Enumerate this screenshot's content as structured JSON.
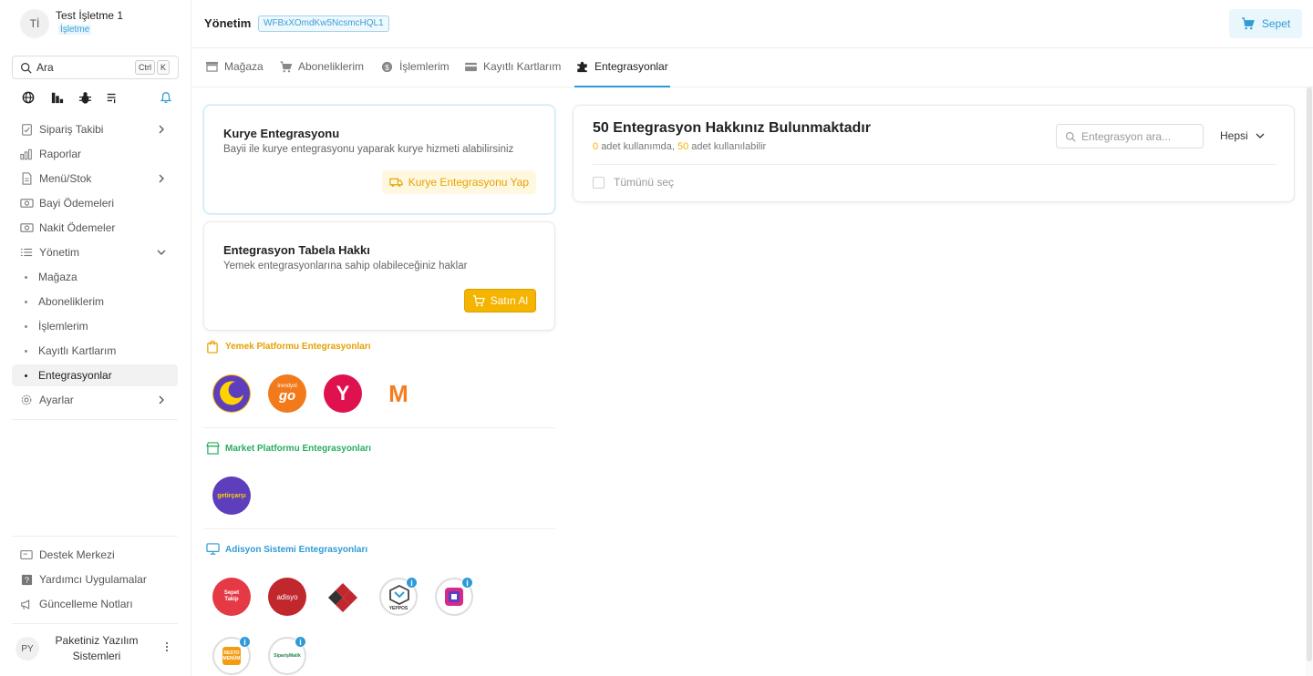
{
  "org": {
    "initials": "Tİ",
    "name": "Test İşletme 1",
    "type": "İşletme"
  },
  "search": {
    "label": "Ara",
    "key1": "Ctrl",
    "key2": "K"
  },
  "quick_icons": [
    "globe-icon",
    "chart-icon",
    "bug-icon",
    "list-icon",
    "bell-icon"
  ],
  "nav": {
    "siparis": "Sipariş Takibi",
    "raporlar": "Raporlar",
    "menu": "Menü/Stok",
    "bayi": "Bayi Ödemeleri",
    "nakit": "Nakit Ödemeler",
    "yonetim": "Yönetim",
    "sub": [
      "Mağaza",
      "Aboneliklerim",
      "İşlemlerim",
      "Kayıtlı Kartlarım",
      "Entegrasyonlar"
    ],
    "ayarlar": "Ayarlar"
  },
  "footer_links": {
    "destek": "Destek Merkezi",
    "yardimci": "Yardımcı Uygulamalar",
    "guncelleme": "Güncelleme Notları"
  },
  "user": {
    "initials": "PY",
    "name": "Paketiniz Yazılım Sistemleri"
  },
  "header": {
    "title": "Yönetim",
    "id": "WFBxXOmdKw5NcsmcHQL1",
    "cart": "Sepet"
  },
  "tabs": [
    "Mağaza",
    "Aboneliklerim",
    "İşlemlerim",
    "Kayıtlı Kartlarım",
    "Entegrasyonlar"
  ],
  "courier_card": {
    "title": "Kurye Entegrasyonu",
    "desc": "Bayii ile kurye entegrasyonu yaparak kurye hizmeti alabilirsiniz",
    "button": "Kurye Entegrasyonu Yap"
  },
  "sign_card": {
    "title": "Entegrasyon Tabela Hakkı",
    "desc": "Yemek entegrasyonlarına sahip olabileceğiniz haklar",
    "button": "Satın Al"
  },
  "sections": {
    "yemek": {
      "title": "Yemek Platformu Entegrasyonları",
      "color": "#e6a100"
    },
    "market": {
      "title": "Market Platformu Entegrasyonları",
      "color": "#27ae60"
    },
    "adisyon": {
      "title": "Adisyon Sistemi Entegrasyonları",
      "color": "#2f9bd6"
    }
  },
  "logos": {
    "yemek": [
      "migros-logo",
      "trendyolgo-logo",
      "yemeksepeti-logo",
      "m-logo"
    ],
    "trendyol_text": "trendyol",
    "trendyol_go": "go",
    "yemeksepeti_text": "Y",
    "m_text": "M",
    "getir_text": "getirçarşı",
    "sepet_text1": "Sepet",
    "sepet_text2": "Takip",
    "adisyo_text": "adisyo",
    "yeppos_text": "YEPPOS",
    "resto_text1": "RESTO",
    "resto_text2": "MENÜM",
    "siparis_text": "SiparişMatik"
  },
  "panel": {
    "title": "50 Entegrasyon Hakkınız Bulunmaktadır",
    "used": "0",
    "used_label": "adet kullanımda,",
    "avail": "50",
    "avail_label": "adet kullanılabilir",
    "search_placeholder": "Entegrasyon ara...",
    "filter": "Hepsi",
    "select_all": "Tümünü seç"
  },
  "colors": {
    "accent": "#2f9bd6",
    "warning": "#f4b400"
  }
}
